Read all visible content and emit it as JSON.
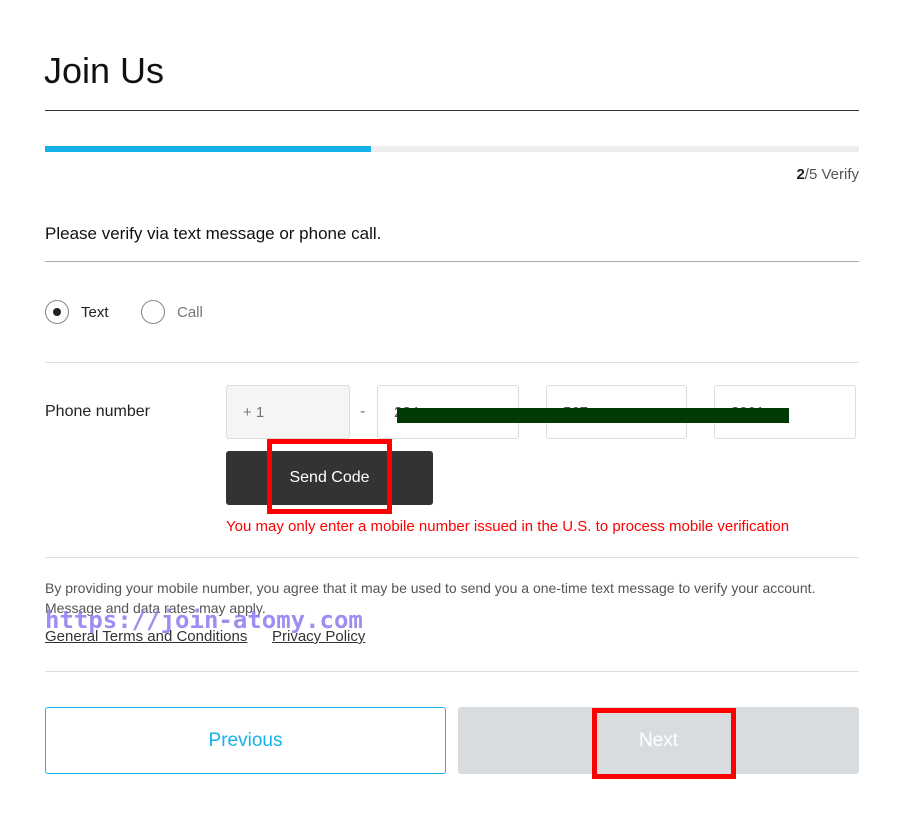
{
  "title": "Join Us",
  "progress": {
    "percent": 40,
    "step_current": "2",
    "step_rest": "/5 Verify"
  },
  "instruction": "Please verify via text message or phone call.",
  "methods": [
    {
      "label": "Text",
      "selected": true
    },
    {
      "label": "Call",
      "selected": false
    }
  ],
  "phone": {
    "label": "Phone number",
    "country_code": "+ 1",
    "separator": "-",
    "part1": "234",
    "part2": "567",
    "part3": "8901"
  },
  "send_code_label": "Send Code",
  "error": "You may only enter a mobile number issued in the U.S. to process mobile verification",
  "notice": "By providing your mobile number, you agree that it may be used to send you a one-time text message to verify your account. Message and data rates may apply.",
  "watermark": "https://join-atomy.com",
  "links": {
    "terms": "General Terms and Conditions",
    "privacy": "Privacy Policy"
  },
  "buttons": {
    "previous": "Previous",
    "next": "Next"
  },
  "colors": {
    "accent": "#14b2e8",
    "error": "#ff0000",
    "highlight": "#ff0000"
  }
}
